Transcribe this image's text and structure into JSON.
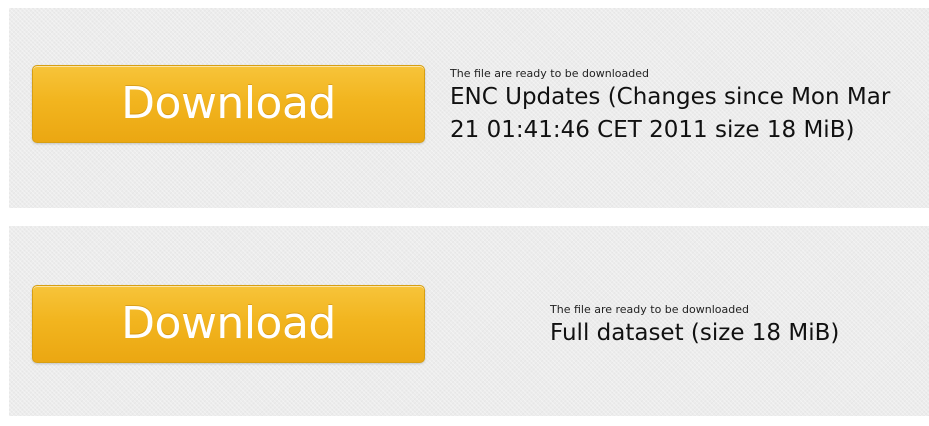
{
  "items": [
    {
      "button_label": "Download",
      "caption": "The file are ready to be downloaded",
      "title": "ENC Updates (Changes since Mon Mar 21 01:41:46 CET 2011 size 18 MiB)"
    },
    {
      "button_label": "Download",
      "caption": "The file are ready to be downloaded",
      "title": "Full dataset (size 18 MiB)"
    }
  ],
  "colors": {
    "button_top": "#f7c43a",
    "button_bottom": "#eba712",
    "panel_background": "#ececec",
    "button_text": "#ffffff"
  }
}
